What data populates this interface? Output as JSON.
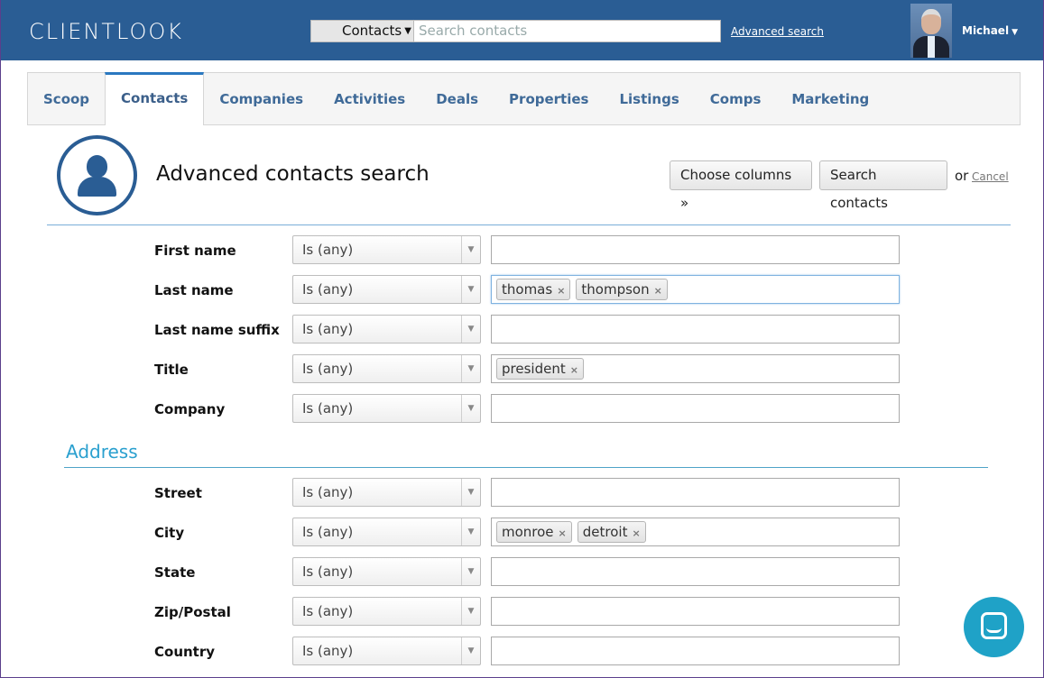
{
  "header": {
    "logo": "CLIENTLOOK",
    "search_scope": "Contacts",
    "search_placeholder": "Search contacts",
    "advanced_search_label": "Advanced search",
    "user_name": "Michael"
  },
  "tabs": [
    {
      "label": "Scoop"
    },
    {
      "label": "Contacts",
      "active": true
    },
    {
      "label": "Companies"
    },
    {
      "label": "Activities"
    },
    {
      "label": "Deals"
    },
    {
      "label": "Properties"
    },
    {
      "label": "Listings"
    },
    {
      "label": "Comps"
    },
    {
      "label": "Marketing"
    }
  ],
  "page": {
    "title": "Advanced contacts search",
    "choose_columns_label": "Choose columns »",
    "search_button_label": "Search contacts",
    "or_text": "or",
    "cancel_label": "Cancel",
    "address_section_title": "Address"
  },
  "fields": [
    {
      "label": "First name",
      "operator": "Is (any)",
      "tokens": []
    },
    {
      "label": "Last name",
      "operator": "Is (any)",
      "tokens": [
        "thomas",
        "thompson"
      ],
      "focused": true
    },
    {
      "label": "Last name suffix",
      "operator": "Is (any)",
      "tokens": []
    },
    {
      "label": "Title",
      "operator": "Is (any)",
      "tokens": [
        "president"
      ]
    },
    {
      "label": "Company",
      "operator": "Is (any)",
      "tokens": []
    }
  ],
  "address_fields": [
    {
      "label": "Street",
      "operator": "Is (any)",
      "tokens": []
    },
    {
      "label": "City",
      "operator": "Is (any)",
      "tokens": [
        "monroe",
        "detroit"
      ]
    },
    {
      "label": "State",
      "operator": "Is (any)",
      "tokens": []
    },
    {
      "label": "Zip/Postal",
      "operator": "Is (any)",
      "tokens": []
    },
    {
      "label": "Country",
      "operator": "Is (any)",
      "tokens": []
    }
  ],
  "icons": {
    "remove_token": "×",
    "dropdown": "▼"
  },
  "colors": {
    "header_bg": "#2a5d94",
    "tab_text": "#3f6a98",
    "section_accent": "#2aa0cf",
    "chat_bg": "#1fa2c7"
  }
}
